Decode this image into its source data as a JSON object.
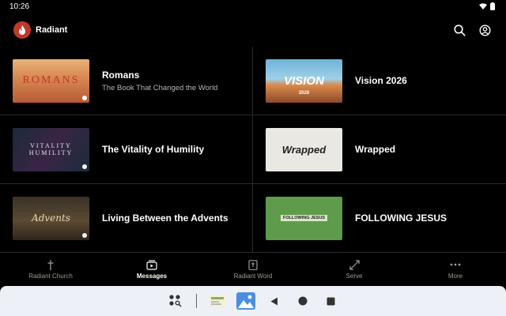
{
  "status": {
    "time": "10:26"
  },
  "app": {
    "title": "Radiant"
  },
  "cards": [
    {
      "title": "Romans",
      "subtitle": "The Book That Changed the World",
      "thumb_text": "ROMANS"
    },
    {
      "title": "Vision 2026",
      "subtitle": "",
      "thumb_text": "VISION",
      "thumb_sub": "2026"
    },
    {
      "title": "The Vitality of Humility",
      "subtitle": "",
      "thumb_text": "VITALITY HUMILITY"
    },
    {
      "title": "Wrapped",
      "subtitle": "",
      "thumb_text": "Wrapped"
    },
    {
      "title": "Living Between the Advents",
      "subtitle": "",
      "thumb_text": "Advents"
    },
    {
      "title": "FOLLOWING JESUS",
      "subtitle": "",
      "thumb_text": "FOLLOWING JESUS"
    }
  ],
  "nav": [
    {
      "label": "Radiant Church",
      "icon": "cross-icon",
      "active": false
    },
    {
      "label": "Messages",
      "icon": "play-stack-icon",
      "active": true
    },
    {
      "label": "Radiant Word",
      "icon": "bible-icon",
      "active": false
    },
    {
      "label": "Serve",
      "icon": "arrows-icon",
      "active": false
    },
    {
      "label": "More",
      "icon": "more-icon",
      "active": false
    }
  ],
  "colors": {
    "accent": "#c0392b",
    "background": "#000000",
    "system_nav": "#eef0f7"
  }
}
